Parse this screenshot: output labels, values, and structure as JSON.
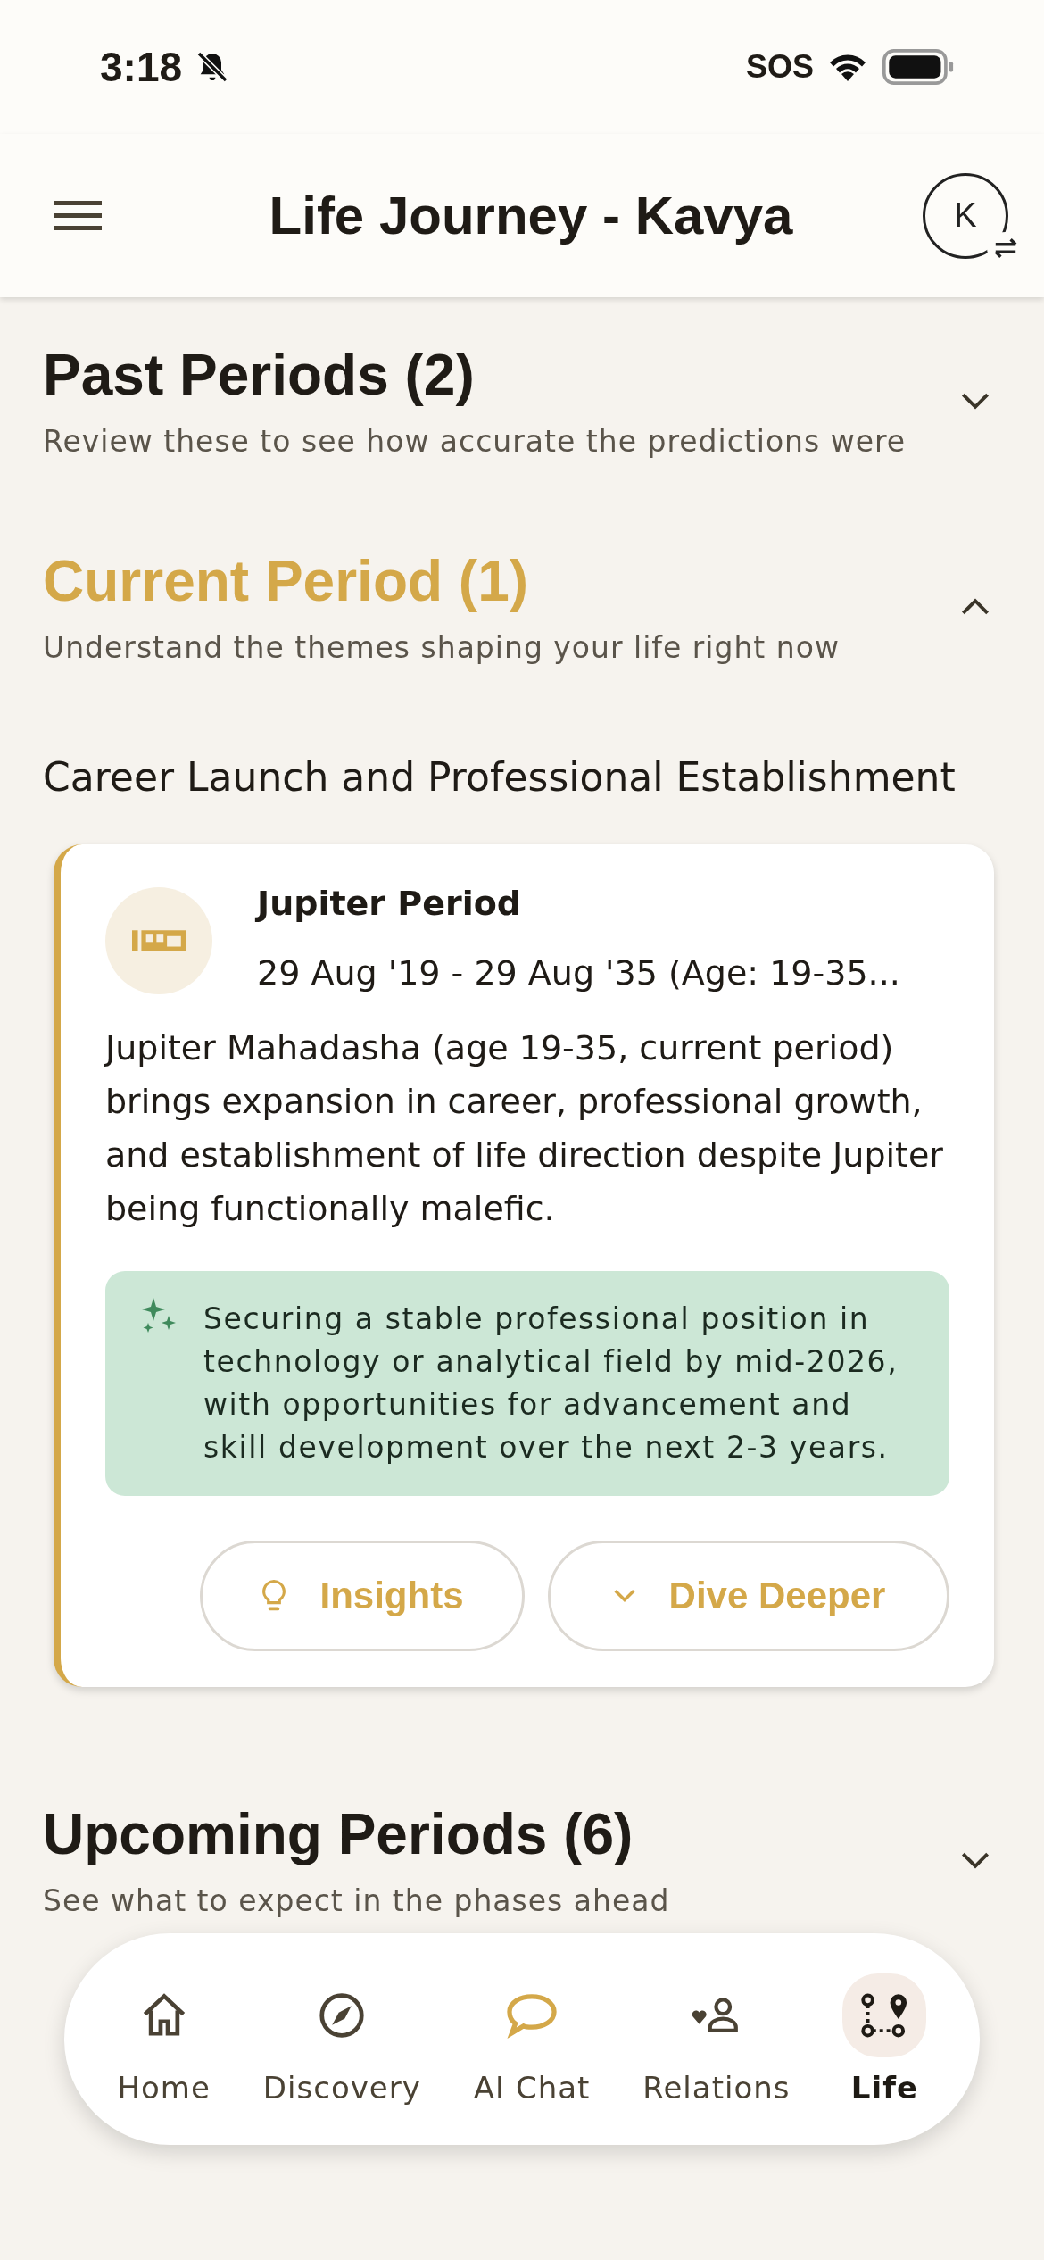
{
  "status_bar": {
    "time": "3:18",
    "carrier": "SOS"
  },
  "header": {
    "title": "Life Journey - Kavya",
    "avatar_initial": "K"
  },
  "sections": [
    {
      "title": "Past Periods (2)",
      "subtitle": "Review these to see how accurate the predictions were",
      "expanded": false,
      "current": false
    },
    {
      "title": "Current Period (1)",
      "subtitle": "Understand the themes shaping your life right now",
      "expanded": true,
      "current": true,
      "theme": "Career Launch and Professional Establishment",
      "cards": [
        {
          "title": "Jupiter Period",
          "dates": "29 Aug '19 - 29 Aug '35 (Age: 19-35...",
          "description": "Jupiter Mahadasha (age 19-35, current period) brings expansion in career, professional growth, and establishment of life direction despite Jupiter being functionally malefic.",
          "prediction": "Securing a stable professional position in technology or analytical field by mid-2026, with opportunities for advancement and skill development over the next 2-3 years.",
          "buttons": [
            {
              "kind": "insights",
              "label": "Insights"
            },
            {
              "kind": "dive",
              "label": "Dive Deeper"
            }
          ]
        }
      ]
    },
    {
      "title": "Upcoming Periods (6)",
      "subtitle": "See what to expect in the phases ahead",
      "expanded": false,
      "current": false
    }
  ],
  "nav": [
    {
      "kind": "home",
      "label": "Home",
      "selected": false,
      "highlighted": false
    },
    {
      "kind": "discovery",
      "label": "Discovery",
      "selected": false,
      "highlighted": false
    },
    {
      "kind": "chat",
      "label": "AI Chat",
      "selected": false,
      "highlighted": true
    },
    {
      "kind": "relations",
      "label": "Relations",
      "selected": false,
      "highlighted": false
    },
    {
      "kind": "life",
      "label": "Life",
      "selected": true,
      "highlighted": false
    }
  ]
}
